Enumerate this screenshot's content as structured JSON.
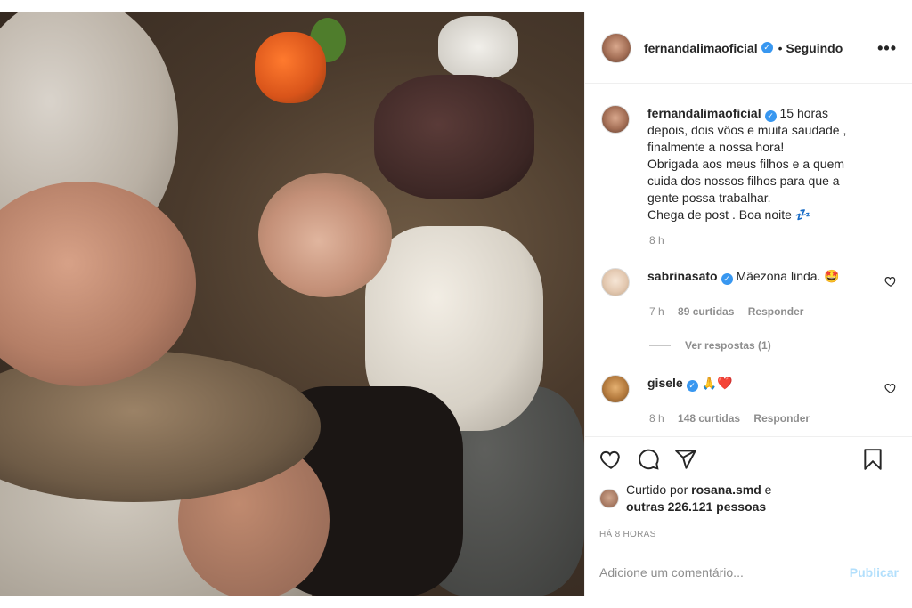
{
  "post": {
    "author": "fernandalimaoficial",
    "follow_state": "Seguindo",
    "caption": "15 horas depois, dois vôos e muita saudade , finalmente a nossa hora!\nObrigada aos meus filhos e a quem cuida dos nossos filhos para que a gente possa trabalhar.\nChega de post . Boa noite 💤",
    "caption_time": "8 h"
  },
  "comments": [
    {
      "user": "sabrinasato",
      "text": "Mãezona linda. 🤩",
      "time": "7 h",
      "likes": "89 curtidas",
      "reply": "Responder",
      "view_replies": "Ver respostas (1)"
    },
    {
      "user": "gisele",
      "text": "🙏❤️",
      "time": "8 h",
      "likes": "148 curtidas",
      "reply": "Responder"
    }
  ],
  "likes_summary": {
    "prefix": "Curtido por",
    "user": "rosana.smd",
    "joiner": "e",
    "others": "outras 226.121 pessoas"
  },
  "timestamp": "HÁ 8 HORAS",
  "add_comment": {
    "placeholder": "Adicione um comentário...",
    "publish": "Publicar"
  },
  "icons": [
    "heart-icon",
    "comment-icon",
    "share-icon",
    "bookmark-icon",
    "more-icon",
    "verified-icon"
  ],
  "colors": {
    "verified": "#3897f0",
    "publish_disabled": "#b2dffc",
    "meta": "#8e8e8e"
  }
}
